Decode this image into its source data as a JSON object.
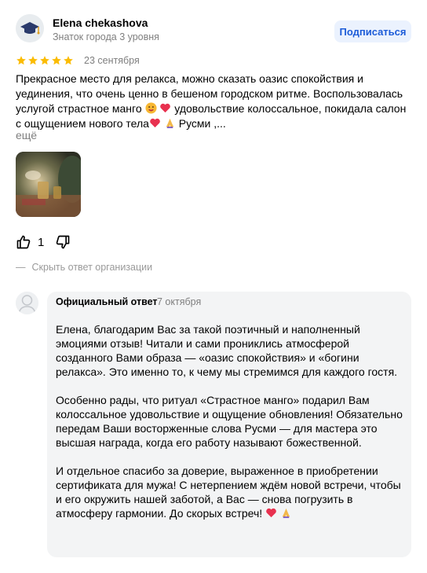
{
  "reviewer": {
    "name": "Elena chekashova",
    "level": "Знаток города 3 уровня",
    "subscribe_label": "Подписаться"
  },
  "review": {
    "rating": 5,
    "date": "23 сентября",
    "text_part1": "Прекрасное место для релакса, можно сказать оазис спокойствия и уединения, что очень ценно в бешеном городском ритме. Воспользовалась услугой страстное манго",
    "text_part2": "удовольствие колоссальное, покидала салон с ощущением нового тела",
    "text_part3": "Русми ,...",
    "more_label": "ещё",
    "likes": "1"
  },
  "hide_reply_label": "Скрыть ответ организации",
  "org_reply": {
    "title": "Официальный ответ",
    "date": "7 октября",
    "paragraph1": "Елена, благодарим Вас за такой поэтичный и наполненный эмоциями отзыв! Читали и сами прониклись атмосферой созданного Вами образа — «оазис спокойствия» и «богини релакса». Это именно то, к чему мы стремимся для каждого гостя.",
    "paragraph2": "Особенно рады, что ритуал «Страстное манго» подарил Вам колоссальное удовольствие и ощущение обновления! Обязательно передам Ваши восторженные слова Русми — для мастера это высшая награда, когда его работу называют божественной.",
    "paragraph3": "И отдельное спасибо за доверие, выраженное в приобретении сертификата для мужа! С нетерпением ждём новой встречи, чтобы и его окружить нашей заботой, а Вас — снова погрузить в атмосферу гармонии. До скорых встреч!"
  },
  "colors": {
    "star": "#fbbc04",
    "accent": "#1d5cd8",
    "muted": "#7f7f7f"
  },
  "icons": [
    "graduation-cap-icon",
    "star-icon",
    "thumbs-up-icon",
    "thumbs-down-icon",
    "heart-emoji",
    "praying-hands-emoji"
  ]
}
